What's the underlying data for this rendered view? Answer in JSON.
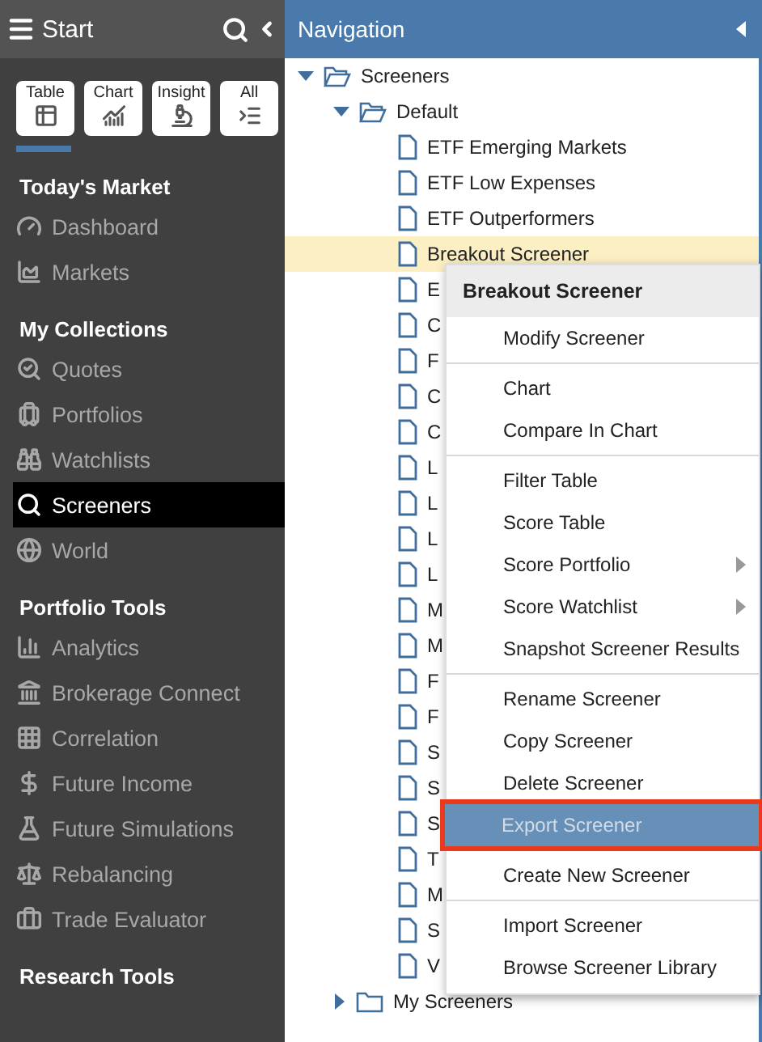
{
  "sidebar": {
    "title": "Start",
    "view_tabs": [
      {
        "label": "Table",
        "selected": true
      },
      {
        "label": "Chart",
        "selected": false
      },
      {
        "label": "Insight",
        "selected": false
      },
      {
        "label": "All",
        "selected": false
      }
    ],
    "sections": [
      {
        "heading": "Today's Market",
        "items": [
          {
            "label": "Dashboard",
            "selected": false
          },
          {
            "label": "Markets",
            "selected": false
          }
        ]
      },
      {
        "heading": "My Collections",
        "items": [
          {
            "label": "Quotes",
            "selected": false
          },
          {
            "label": "Portfolios",
            "selected": false
          },
          {
            "label": "Watchlists",
            "selected": false
          },
          {
            "label": "Screeners",
            "selected": true
          },
          {
            "label": "World",
            "selected": false
          }
        ]
      },
      {
        "heading": "Portfolio Tools",
        "items": [
          {
            "label": "Analytics",
            "selected": false
          },
          {
            "label": "Brokerage Connect",
            "selected": false
          },
          {
            "label": "Correlation",
            "selected": false
          },
          {
            "label": "Future Income",
            "selected": false
          },
          {
            "label": "Future Simulations",
            "selected": false
          },
          {
            "label": "Rebalancing",
            "selected": false
          },
          {
            "label": "Trade Evaluator",
            "selected": false
          }
        ]
      },
      {
        "heading": "Research Tools"
      }
    ]
  },
  "navigation": {
    "title": "Navigation",
    "tree": [
      {
        "kind": "folder",
        "label": "Screeners",
        "expanded": true,
        "selected": false,
        "children": [
          {
            "kind": "folder",
            "label": "Default",
            "expanded": true,
            "selected": false,
            "children": [
              {
                "kind": "file",
                "label": "ETF Emerging Markets",
                "selected": false
              },
              {
                "kind": "file",
                "label": "ETF Low Expenses",
                "selected": false
              },
              {
                "kind": "file",
                "label": "ETF Outperformers",
                "selected": false
              },
              {
                "kind": "file",
                "label": "Breakout Screener",
                "selected": true
              },
              {
                "kind": "file",
                "label": "E",
                "selected": false
              },
              {
                "kind": "file",
                "label": "C",
                "selected": false
              },
              {
                "kind": "file",
                "label": "F",
                "selected": false
              },
              {
                "kind": "file",
                "label": "C",
                "selected": false
              },
              {
                "kind": "file",
                "label": "C",
                "selected": false
              },
              {
                "kind": "file",
                "label": "L",
                "selected": false
              },
              {
                "kind": "file",
                "label": "L",
                "selected": false
              },
              {
                "kind": "file",
                "label": "L",
                "selected": false
              },
              {
                "kind": "file",
                "label": "L",
                "selected": false
              },
              {
                "kind": "file",
                "label": "M",
                "selected": false
              },
              {
                "kind": "file",
                "label": "M",
                "selected": false
              },
              {
                "kind": "file",
                "label": "F",
                "selected": false
              },
              {
                "kind": "file",
                "label": "F",
                "selected": false
              },
              {
                "kind": "file",
                "label": "S",
                "selected": false
              },
              {
                "kind": "file",
                "label": "S",
                "selected": false
              },
              {
                "kind": "file",
                "label": "S",
                "selected": false
              },
              {
                "kind": "file",
                "label": "T",
                "selected": false
              },
              {
                "kind": "file",
                "label": "M",
                "selected": false
              },
              {
                "kind": "file",
                "label": "S",
                "selected": false
              },
              {
                "kind": "file",
                "label": "V",
                "selected": false
              }
            ]
          },
          {
            "kind": "folder",
            "label": "My Screeners",
            "expanded": false,
            "selected": false
          }
        ]
      }
    ]
  },
  "context_menu": {
    "title": "Breakout Screener",
    "items": [
      {
        "kind": "item",
        "label": "Modify Screener",
        "submenu": false,
        "highlighted": false
      },
      {
        "kind": "separator"
      },
      {
        "kind": "item",
        "label": "Chart",
        "submenu": false,
        "highlighted": false
      },
      {
        "kind": "item",
        "label": "Compare In Chart",
        "submenu": false,
        "highlighted": false
      },
      {
        "kind": "separator"
      },
      {
        "kind": "item",
        "label": "Filter Table",
        "submenu": false,
        "highlighted": false
      },
      {
        "kind": "item",
        "label": "Score Table",
        "submenu": false,
        "highlighted": false
      },
      {
        "kind": "item",
        "label": "Score Portfolio",
        "submenu": true,
        "highlighted": false
      },
      {
        "kind": "item",
        "label": "Score Watchlist",
        "submenu": true,
        "highlighted": false
      },
      {
        "kind": "item",
        "label": "Snapshot Screener Results",
        "submenu": false,
        "highlighted": false
      },
      {
        "kind": "separator"
      },
      {
        "kind": "item",
        "label": "Rename Screener",
        "submenu": false,
        "highlighted": false
      },
      {
        "kind": "item",
        "label": "Copy Screener",
        "submenu": false,
        "highlighted": false
      },
      {
        "kind": "item",
        "label": "Delete Screener",
        "submenu": false,
        "highlighted": false
      },
      {
        "kind": "item",
        "label": "Export Screener",
        "submenu": false,
        "highlighted": true
      },
      {
        "kind": "separator"
      },
      {
        "kind": "item",
        "label": "Create New Screener",
        "submenu": false,
        "highlighted": false
      },
      {
        "kind": "separator"
      },
      {
        "kind": "item",
        "label": "Import Screener",
        "submenu": false,
        "highlighted": false
      },
      {
        "kind": "item",
        "label": "Browse Screener Library",
        "submenu": false,
        "highlighted": false
      }
    ]
  }
}
